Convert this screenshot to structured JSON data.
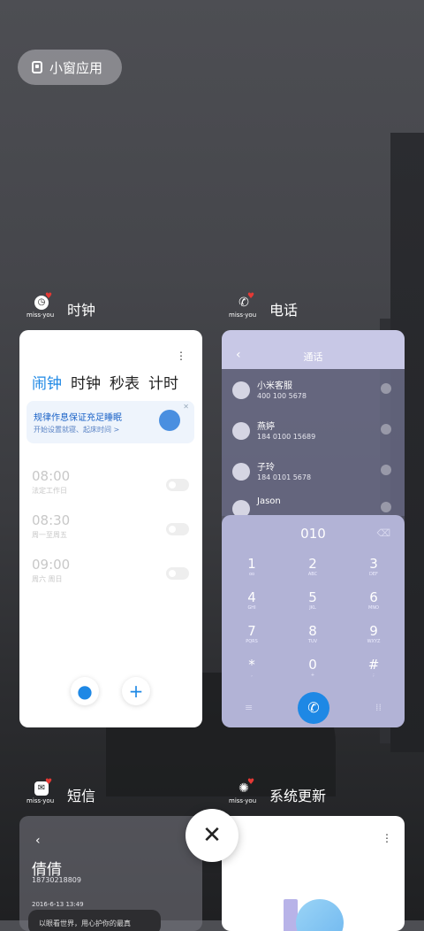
{
  "small_window": {
    "label": "小窗应用"
  },
  "apps": {
    "clock": {
      "name": "时钟",
      "tag": "miss·you"
    },
    "phone": {
      "name": "电话",
      "tag": "miss·you"
    },
    "sms": {
      "name": "短信",
      "tag": "miss·you"
    },
    "update": {
      "name": "系统更新",
      "tag": "miss·you"
    }
  },
  "clock_card": {
    "tabs": [
      "闹钟",
      "时钟",
      "秒表",
      "计时"
    ],
    "banner_title": "规律作息保证充足睡眠",
    "banner_sub": "开始设置就寝、起床时间 >",
    "alarms": [
      {
        "time": "08:00",
        "sub": "法定工作日"
      },
      {
        "time": "08:30",
        "sub": "周一至周五"
      },
      {
        "time": "09:00",
        "sub": "周六 周日"
      }
    ]
  },
  "phone_card": {
    "title": "通话",
    "contacts": [
      {
        "name": "小米客服",
        "num": "400 100 5678"
      },
      {
        "name": "燕婷",
        "num": "184 0100 15689"
      },
      {
        "name": "子玲",
        "num": "184 0101 5678"
      },
      {
        "name": "Jason",
        "num": ""
      }
    ],
    "dialed": "010",
    "keys": [
      {
        "d": "1",
        "l": "oo"
      },
      {
        "d": "2",
        "l": "ABC"
      },
      {
        "d": "3",
        "l": "DEF"
      },
      {
        "d": "4",
        "l": "GHI"
      },
      {
        "d": "5",
        "l": "JKL"
      },
      {
        "d": "6",
        "l": "MNO"
      },
      {
        "d": "7",
        "l": "PQRS"
      },
      {
        "d": "8",
        "l": "TUV"
      },
      {
        "d": "9",
        "l": "WXYZ"
      },
      {
        "d": "*",
        "l": ","
      },
      {
        "d": "0",
        "l": "+"
      },
      {
        "d": "#",
        "l": ";"
      }
    ]
  },
  "sms_card": {
    "contact": "倩倩",
    "number": "18730218809",
    "date": "2016-6-13 13:49",
    "preview": "以眼看世界，用心护你的最真"
  },
  "icons": {
    "close": "close-icon",
    "mic": "mic-icon",
    "add": "plus-icon",
    "call": "phone-call-icon"
  }
}
